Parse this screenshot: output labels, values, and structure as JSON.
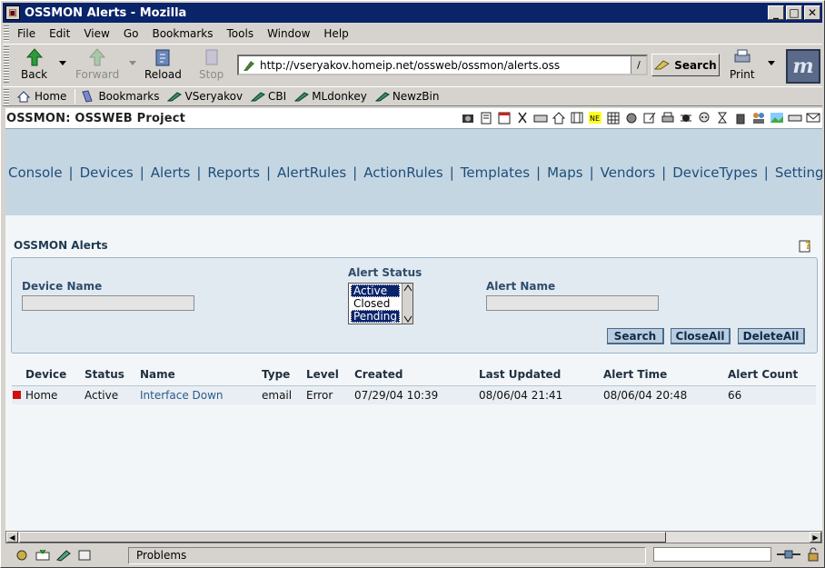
{
  "window": {
    "title": "OSSMON Alerts - Mozilla",
    "minimize_label": "_",
    "maximize_label": "□",
    "close_label": "✕"
  },
  "menu": {
    "file": "File",
    "edit": "Edit",
    "view": "View",
    "go": "Go",
    "bookmarks": "Bookmarks",
    "tools": "Tools",
    "window": "Window",
    "help": "Help"
  },
  "toolbar": {
    "back": "Back",
    "forward": "Forward",
    "reload": "Reload",
    "stop": "Stop",
    "url": "http://vseryakov.homeip.net/ossweb/ossmon/alerts.oss",
    "search": "Search",
    "print": "Print"
  },
  "personal_toolbar": {
    "items": [
      "Home",
      "Bookmarks",
      "VSeryakov",
      "CBI",
      "MLdonkey",
      "NewzBin"
    ]
  },
  "page": {
    "project_title": "OSSMON: OSSWEB Project",
    "nav": [
      "Console",
      "Devices",
      "Alerts",
      "Reports",
      "AlertRules",
      "ActionRules",
      "Templates",
      "Maps",
      "Vendors",
      "DeviceTypes",
      "Settings"
    ],
    "nav_separator": "|",
    "title": "OSSMON Alerts",
    "filter": {
      "device_name_label": "Device Name",
      "device_name_value": "",
      "alert_status_label": "Alert Status",
      "alert_status_options": [
        "Active",
        "Closed",
        "Pending"
      ],
      "alert_status_selected": [
        "Active",
        "Pending"
      ],
      "alert_name_label": "Alert Name",
      "alert_name_value": "",
      "search_button": "Search",
      "closeall_button": "CloseAll",
      "deleteall_button": "DeleteAll"
    },
    "table": {
      "headers": [
        "Device",
        "Status",
        "Name",
        "Type",
        "Level",
        "Created",
        "Last Updated",
        "Alert Time",
        "Alert Count"
      ],
      "rows": [
        {
          "device": "Home",
          "status": "Active",
          "name": "Interface Down",
          "type": "email",
          "level": "Error",
          "created": "07/29/04 10:39",
          "last_updated": "08/06/04 21:41",
          "alert_time": "08/06/04 20:48",
          "alert_count": "66",
          "severity_color": "#d01010"
        }
      ]
    }
  },
  "status": {
    "text": "Problems"
  },
  "colors": {
    "titlebar": "#0a246a",
    "nav_band": "#c5d6e3",
    "nav_text": "#1d4e78",
    "link": "#2b5a8a"
  }
}
